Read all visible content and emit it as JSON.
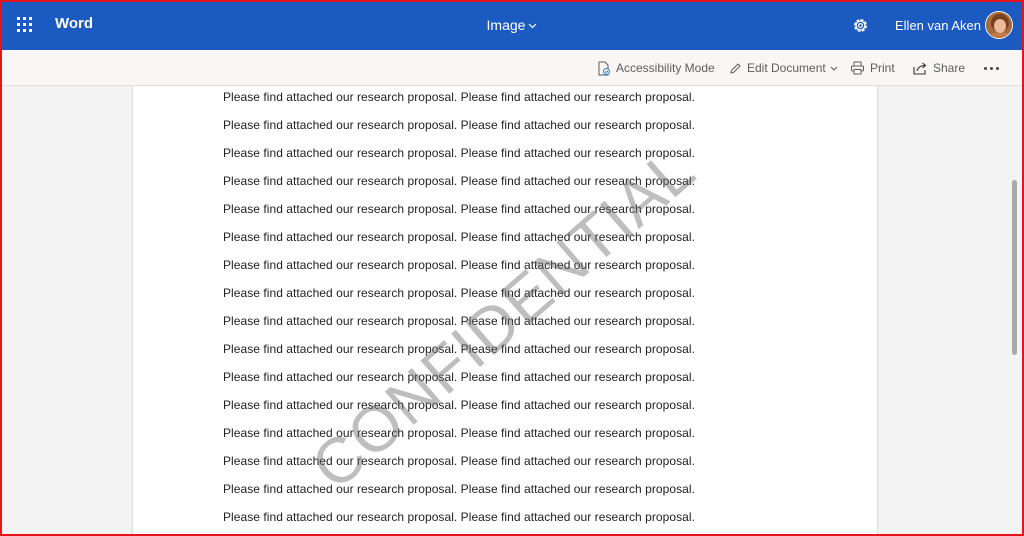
{
  "header": {
    "app_name": "Word",
    "doc_title": "Image",
    "user_name": "Ellen van Aken",
    "brand_color": "#1b5ac0"
  },
  "toolbar": {
    "accessibility_label": "Accessibility Mode",
    "edit_label": "Edit Document",
    "print_label": "Print",
    "share_label": "Share"
  },
  "document": {
    "lines": [
      "Please find attached our research proposal. Please find attached our research proposal.",
      "Please find attached our research proposal. Please find attached our research proposal.",
      "Please find attached our research proposal. Please find attached our research proposal.",
      "Please find attached our research proposal. Please find attached our research proposal.",
      "Please find attached our research proposal. Please find attached our research proposal.",
      "Please find attached our research proposal. Please find attached our research proposal.",
      "Please find attached our research proposal. Please find attached our research proposal.",
      "Please find attached our research proposal. Please find attached our research proposal.",
      "Please find attached our research proposal. Please find attached our research proposal.",
      "Please find attached our research proposal. Please find attached our research proposal.",
      "Please find attached our research proposal. Please find attached our research proposal.",
      "Please find attached our research proposal. Please find attached our research proposal.",
      "Please find attached our research proposal. Please find attached our research proposal.",
      "Please find attached our research proposal. Please find attached our research proposal.",
      "Please find attached our research proposal. Please find attached our research proposal.",
      "Please find attached our research proposal. Please find attached our research proposal."
    ],
    "watermark": "CONFIDENTIAL"
  }
}
